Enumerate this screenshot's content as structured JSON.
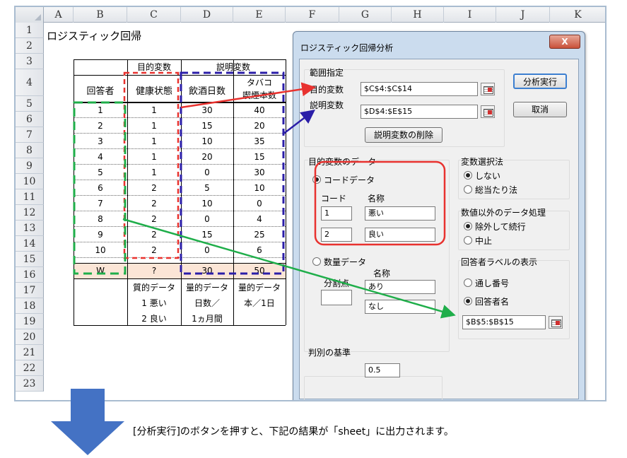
{
  "columns": [
    "A",
    "B",
    "C",
    "D",
    "E",
    "F",
    "G",
    "H",
    "I",
    "J",
    "K"
  ],
  "rows": [
    "1",
    "2",
    "3",
    "4",
    "5",
    "6",
    "7",
    "8",
    "9",
    "10",
    "11",
    "12",
    "13",
    "14",
    "15",
    "16",
    "17",
    "18",
    "19",
    "20",
    "21",
    "22",
    "23"
  ],
  "sheet_title": "ロジスティック回帰",
  "table": {
    "group_target": "目的変数",
    "group_explanatory": "説明変数",
    "header_respondent": "回答者",
    "header_health": "健康状態",
    "header_drink": "飲酒日数",
    "header_smoke_1": "タバコ",
    "header_smoke_2": "喫煙本数",
    "data": [
      [
        "1",
        "1",
        "30",
        "40"
      ],
      [
        "2",
        "1",
        "15",
        "20"
      ],
      [
        "3",
        "1",
        "10",
        "35"
      ],
      [
        "4",
        "1",
        "20",
        "15"
      ],
      [
        "5",
        "1",
        "0",
        "30"
      ],
      [
        "6",
        "2",
        "5",
        "10"
      ],
      [
        "7",
        "2",
        "10",
        "0"
      ],
      [
        "8",
        "2",
        "0",
        "4"
      ],
      [
        "9",
        "2",
        "15",
        "25"
      ],
      [
        "10",
        "2",
        "0",
        "6"
      ]
    ],
    "w_row": [
      "W",
      "?",
      "30",
      "50"
    ],
    "notes": {
      "health_1": "質的データ",
      "health_2": "1 悪い",
      "health_3": "2 良い",
      "drink_1": "量的データ",
      "drink_2": "日数／",
      "drink_3": "1ヵ月間",
      "smoke_1": "量的データ",
      "smoke_2": "本／1日"
    }
  },
  "dialog": {
    "title": "ロジスティック回帰分析",
    "close": "X",
    "range_group": "範囲指定",
    "target_label": "目的変数",
    "target_value": "$C$4:$C$14",
    "explanatory_label": "説明変数",
    "explanatory_value": "$D$4:$E$15",
    "delete_button": "説明変数の削除",
    "run_button": "分析実行",
    "cancel_button": "取消",
    "target_data_group": "目的変数のデータ",
    "code_data": "コードデータ",
    "code_header": "コード",
    "name_header": "名称",
    "code_1": "1",
    "name_1": "悪い",
    "code_2": "2",
    "name_2": "良い",
    "numeric_data": "数量データ",
    "split_point": "分割点",
    "numeric_name_header": "名称",
    "numeric_name_1": "あり",
    "numeric_name_2": "なし",
    "threshold_group": "判別の基準",
    "threshold_value": "0.5",
    "var_select_group": "変数選択法",
    "var_none": "しない",
    "var_all": "総当たり法",
    "nonnum_group": "数値以外のデータ処理",
    "nonnum_exclude": "除外して続行",
    "nonnum_stop": "中止",
    "label_group": "回答者ラベルの表示",
    "label_serial": "通し番号",
    "label_name": "回答者名",
    "label_range": "$B$5:$B$15"
  },
  "caption": "[分析実行]のボタンを押すと、下記の結果が「sheet」に出力されます。",
  "colors": {
    "red_dash": "#e8322f",
    "blue_dash": "#2b1ea8",
    "green_dash": "#1fae4a",
    "arrow_blue": "#4472c4",
    "w_row_fill": "#fbe5d6"
  }
}
